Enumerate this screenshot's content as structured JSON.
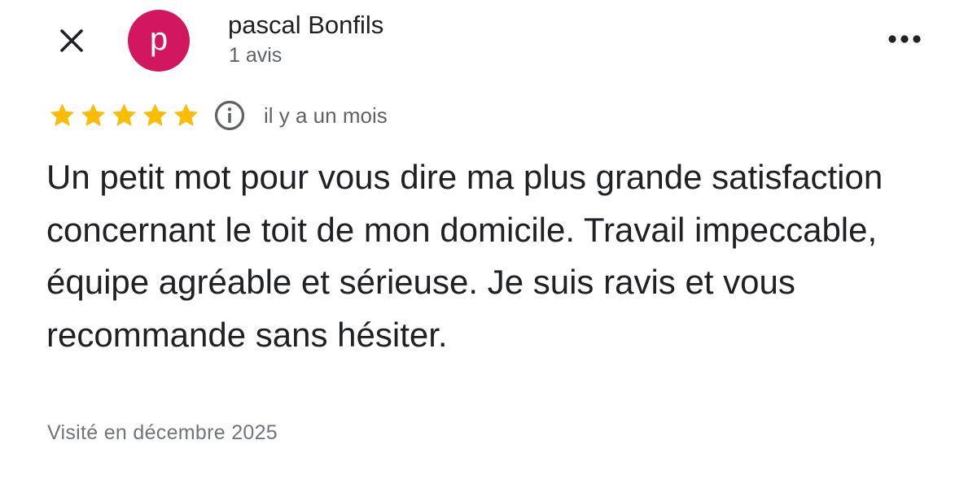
{
  "reviewer": {
    "avatar_letter": "p",
    "avatar_color": "#d3175f",
    "name": "pascal Bonfils",
    "review_count": "1 avis"
  },
  "review": {
    "rating": 5,
    "max_rating": 5,
    "star_color": "#fbbc04",
    "date": "il y a un mois",
    "text": "Un petit mot pour vous dire ma plus grande satisfaction concernant le toit de mon domicile. Travail impeccable, équipe agréable et sérieuse. Je suis ravis et vous recommande sans hésiter.",
    "visited": "Visité en décembre 2025"
  },
  "icons": {
    "close": "close-icon",
    "more": "more-options-icon",
    "info": "info-icon",
    "star": "star-icon"
  }
}
